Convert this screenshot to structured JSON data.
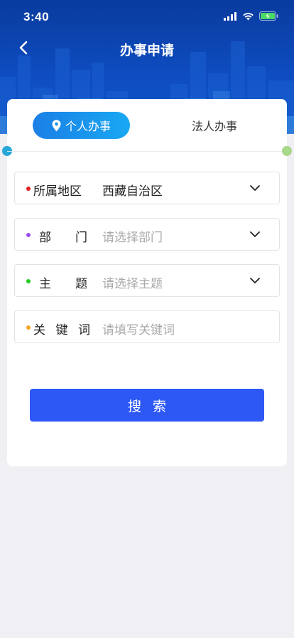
{
  "status_bar": {
    "time": "3:40"
  },
  "header": {
    "title": "办事申请"
  },
  "tabs": [
    {
      "label": "个人办事",
      "active": true
    },
    {
      "label": "法人办事",
      "active": false
    }
  ],
  "form": {
    "region": {
      "label": "所属地区",
      "value": "西藏自治区",
      "bullet_color": "#e02020"
    },
    "department": {
      "label_chars": [
        "部",
        "门"
      ],
      "placeholder": "请选择部门",
      "bullet_color": "#9a4cf0"
    },
    "topic": {
      "label_chars": [
        "主",
        "题"
      ],
      "placeholder": "请选择主题",
      "bullet_color": "#22cc22"
    },
    "keyword": {
      "label_chars": [
        "关",
        "键",
        "词"
      ],
      "placeholder": "请填写关键词",
      "bullet_color": "#f5a623"
    }
  },
  "search_button": {
    "label": "搜索"
  },
  "colors": {
    "header_blue": "#0e4cc0",
    "tab_gradient_start": "#1b7fe6",
    "tab_gradient_end": "#18a8f2",
    "button_blue": "#2e58f5"
  }
}
